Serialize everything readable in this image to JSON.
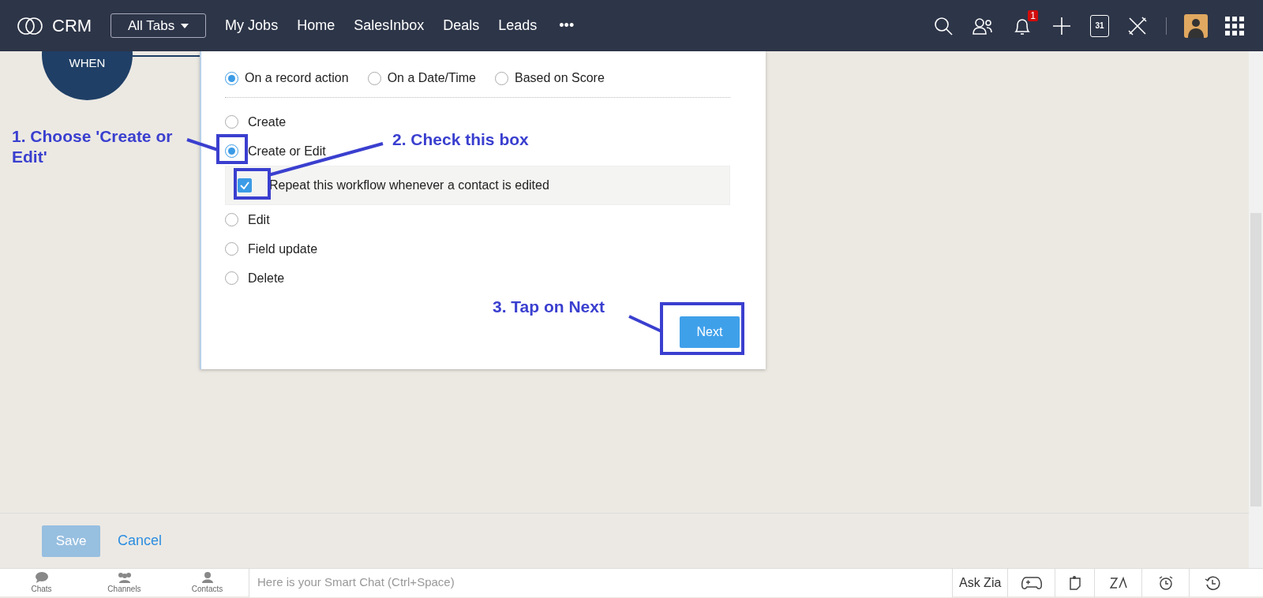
{
  "app": {
    "name": "CRM"
  },
  "nav": {
    "all_tabs": "All Tabs",
    "more": "•••",
    "tabs": [
      {
        "label": "My Jobs",
        "selected": false
      },
      {
        "label": "Home",
        "selected": false
      },
      {
        "label": "SalesInbox",
        "selected": false
      },
      {
        "label": "Deals",
        "selected": false
      },
      {
        "label": "Leads",
        "selected": false
      }
    ]
  },
  "header_icons": {
    "notification_count": "1",
    "calendar_day": "31"
  },
  "flow_node": {
    "label": "WHEN"
  },
  "trigger_types": [
    {
      "label": "On a record action",
      "selected": true
    },
    {
      "label": "On a Date/Time",
      "selected": false
    },
    {
      "label": "Based on Score",
      "selected": false
    }
  ],
  "record_actions": [
    {
      "label": "Create",
      "selected": false
    },
    {
      "label": "Create or Edit",
      "selected": true,
      "option": {
        "label": "Repeat this workflow whenever a contact is edited",
        "checked": true
      }
    },
    {
      "label": "Edit",
      "selected": false
    },
    {
      "label": "Field update",
      "selected": false
    },
    {
      "label": "Delete",
      "selected": false
    }
  ],
  "next_button": "Next",
  "footer": {
    "save": "Save",
    "save_disabled": true,
    "cancel": "Cancel"
  },
  "chat_bar": {
    "tabs": [
      {
        "label": "Chats",
        "kind": "chat"
      },
      {
        "label": "Channels",
        "kind": "channels"
      },
      {
        "label": "Contacts",
        "kind": "contact"
      }
    ],
    "placeholder": "Here is your Smart Chat (Ctrl+Space)",
    "ask_zia": "Ask Zia"
  },
  "annotations": [
    {
      "text": "1. Choose 'Create or Edit'"
    },
    {
      "text": "2. Check this box"
    },
    {
      "text": "3. Tap on Next"
    }
  ]
}
